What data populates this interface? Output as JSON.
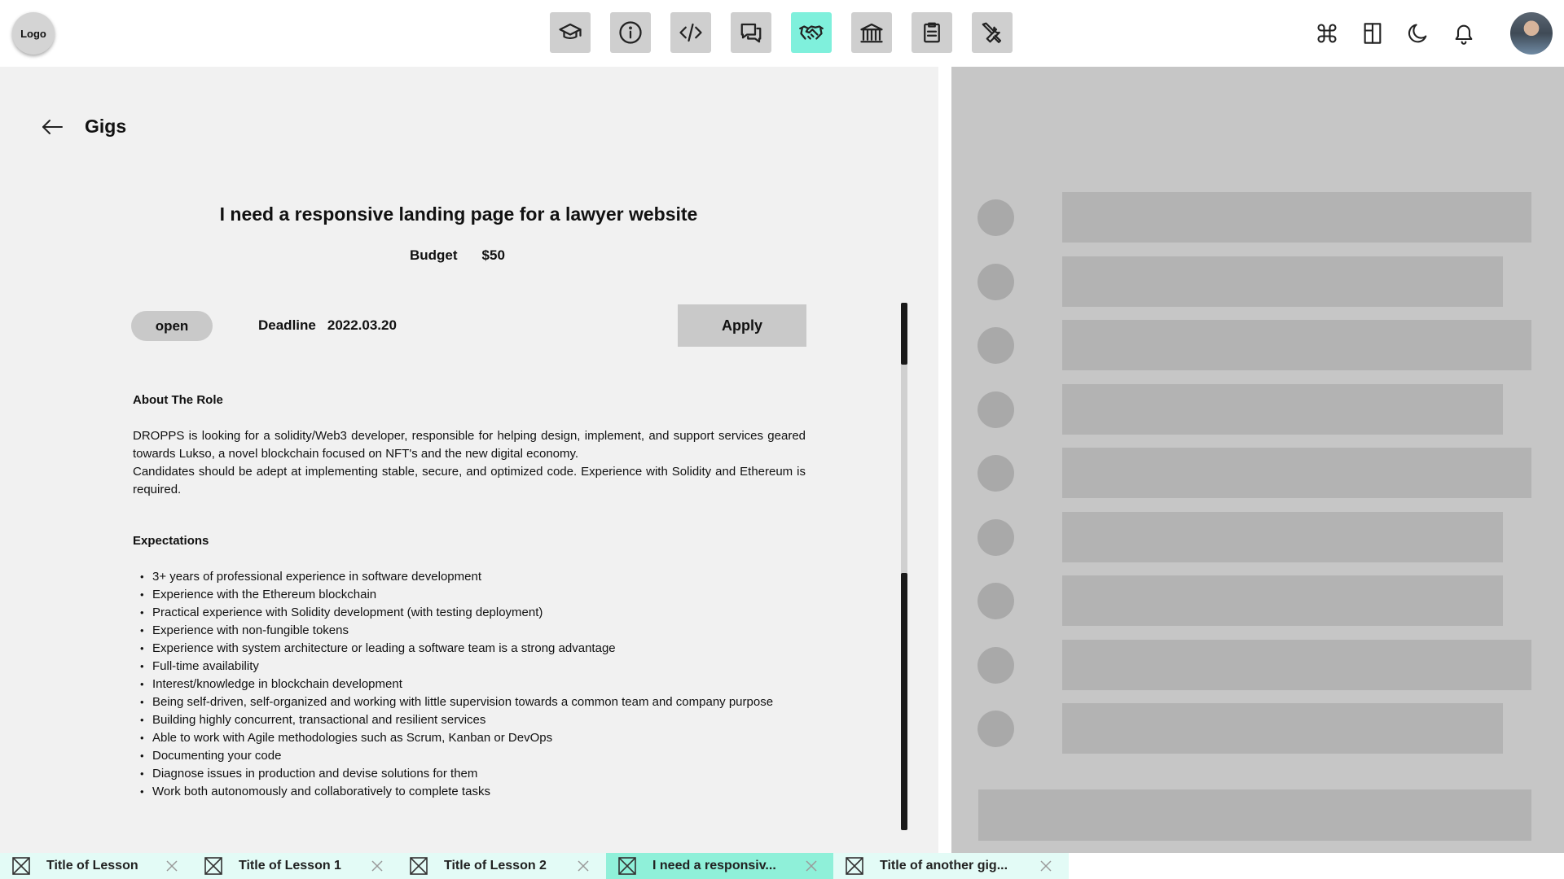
{
  "header": {
    "logo_label": "Logo",
    "nav_items": [
      {
        "icon": "graduation-cap-icon",
        "active": false
      },
      {
        "icon": "info-icon",
        "active": false
      },
      {
        "icon": "code-icon",
        "active": false
      },
      {
        "icon": "chat-icon",
        "active": false
      },
      {
        "icon": "handshake-icon",
        "active": true
      },
      {
        "icon": "bank-icon",
        "active": false
      },
      {
        "icon": "clipboard-icon",
        "active": false
      },
      {
        "icon": "tools-icon",
        "active": false
      }
    ],
    "right_icons": [
      "command-icon",
      "layout-icon",
      "moon-icon",
      "bell-icon",
      "avatar"
    ],
    "accent_color": "#7ff0dc"
  },
  "main": {
    "page_title": "Gigs",
    "gig_title": "I need a responsive landing page for a lawyer website",
    "budget_label": "Budget",
    "budget_value": "$50",
    "status": "open",
    "deadline_label": "Deadline",
    "deadline_value": "2022.03.20",
    "apply_label": "Apply",
    "about_heading": "About The Role",
    "about_paragraphs": [
      "DROPPS is looking for a solidity/Web3 developer, responsible for helping design, implement, and support services geared towards Lukso, a novel blockchain focused on NFT's and the new digital economy.",
      "Candidates should be adept at implementing stable, secure, and optimized code. Experience with Solidity and Ethereum is required."
    ],
    "expectations_heading": "Expectations",
    "expectations": [
      "3+ years of professional experience in software development",
      "Experience with the Ethereum blockchain",
      "Practical experience with Solidity development (with testing deployment)",
      "Experience with non-fungible tokens",
      "Experience with system architecture or leading a software team is a strong advantage",
      "Full-time availability",
      "Interest/knowledge in blockchain development",
      "Being self-driven, self-organized and working with little supervision towards a common team and company purpose",
      "Building highly concurrent, transactional and resilient services",
      "Able to work with Agile methodologies such as Scrum, Kanban or DevOps",
      "Documenting your code",
      "Diagnose issues in production and devise solutions for them",
      "Work both autonomously and collaboratively to complete tasks"
    ]
  },
  "sidebar": {
    "skeleton_row_count": 9
  },
  "tabs": [
    {
      "label": "Title of Lesson",
      "active": false
    },
    {
      "label": "Title of Lesson 1",
      "active": false
    },
    {
      "label": "Title of Lesson 2",
      "active": false
    },
    {
      "label": "I need a responsiv...",
      "active": true
    },
    {
      "label": "Title of another gig...",
      "active": false
    }
  ]
}
